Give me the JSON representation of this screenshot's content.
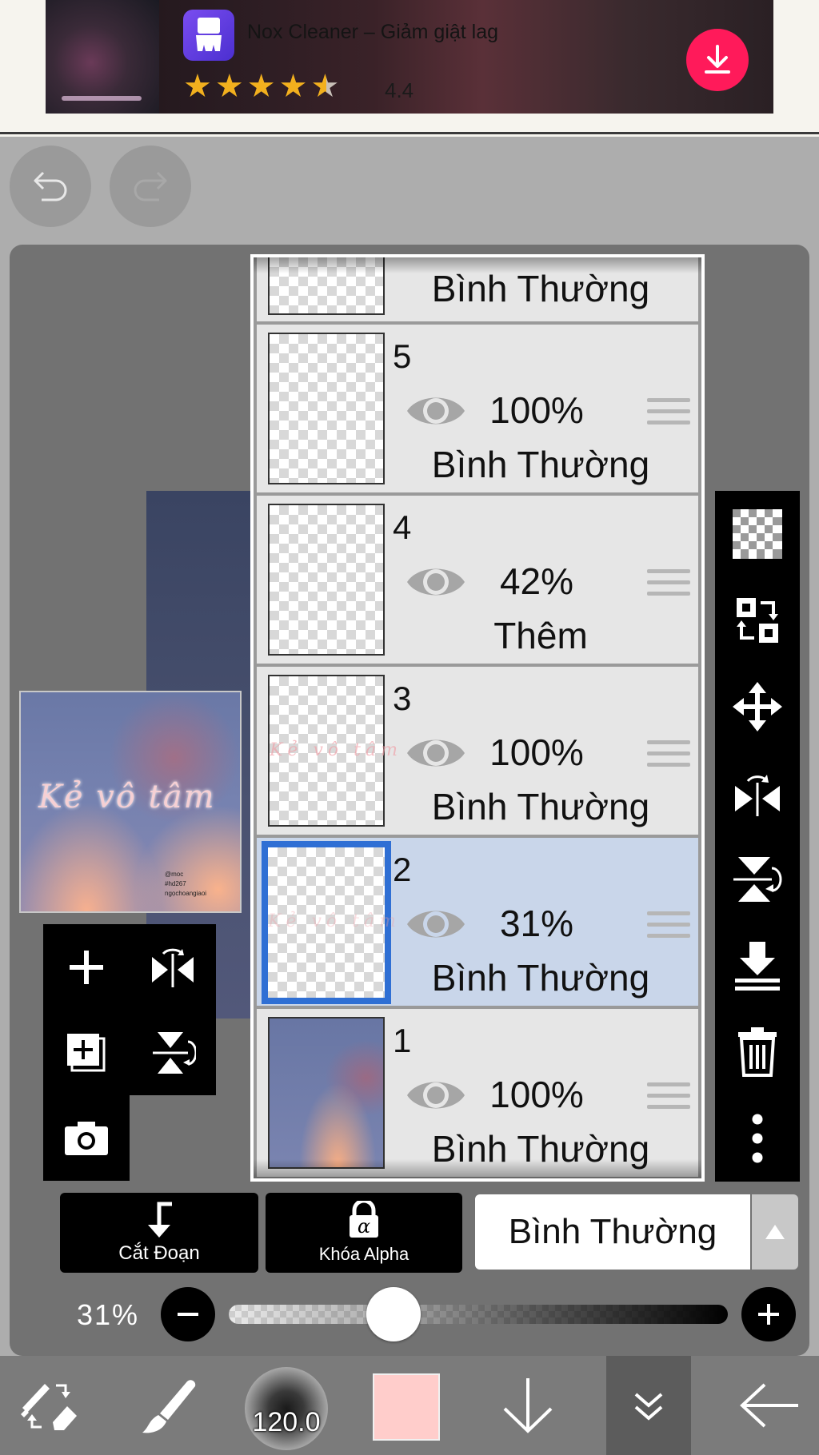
{
  "ad": {
    "app_name": "Nox Cleaner – Giảm giật lag",
    "stars": [
      "★",
      "★",
      "★",
      "★"
    ],
    "half_star": "★",
    "rating": "4.4",
    "brand_color": "#ff1a5a",
    "icon": "broom-icon"
  },
  "header": {
    "undo_icon": "undo-icon",
    "redo_icon": "redo-icon"
  },
  "preview": {
    "text": "Kẻ vô tâm",
    "small_lines": [
      "@moc",
      "#hd267",
      "ngọchoangiaoi"
    ]
  },
  "layers": {
    "top_partial": {
      "blend": "Bình Thường"
    },
    "items": [
      {
        "number": "5",
        "opacity": "100%",
        "blend": "Bình Thường",
        "selected": false,
        "thumb": "empty"
      },
      {
        "number": "4",
        "opacity": "42%",
        "blend": "Thêm",
        "selected": false,
        "thumb": "empty"
      },
      {
        "number": "3",
        "opacity": "100%",
        "blend": "Bình Thường",
        "selected": false,
        "thumb": "text"
      },
      {
        "number": "2",
        "opacity": "31%",
        "blend": "Bình Thường",
        "selected": true,
        "thumb": "text"
      },
      {
        "number": "1",
        "opacity": "100%",
        "blend": "Bình Thường",
        "selected": false,
        "thumb": "photo"
      }
    ],
    "selected_color": "#2f6fd4"
  },
  "controls": {
    "clipping_label": "Cắt Đoạn",
    "alpha_lock_label": "Khóa Alpha",
    "alpha_glyph": "α",
    "blend_mode": "Bình Thường",
    "opacity_label": "31%",
    "opacity_value": 0.31
  },
  "bottom_bar": {
    "brush_size": "120.0",
    "color": "#ffcdcb"
  }
}
